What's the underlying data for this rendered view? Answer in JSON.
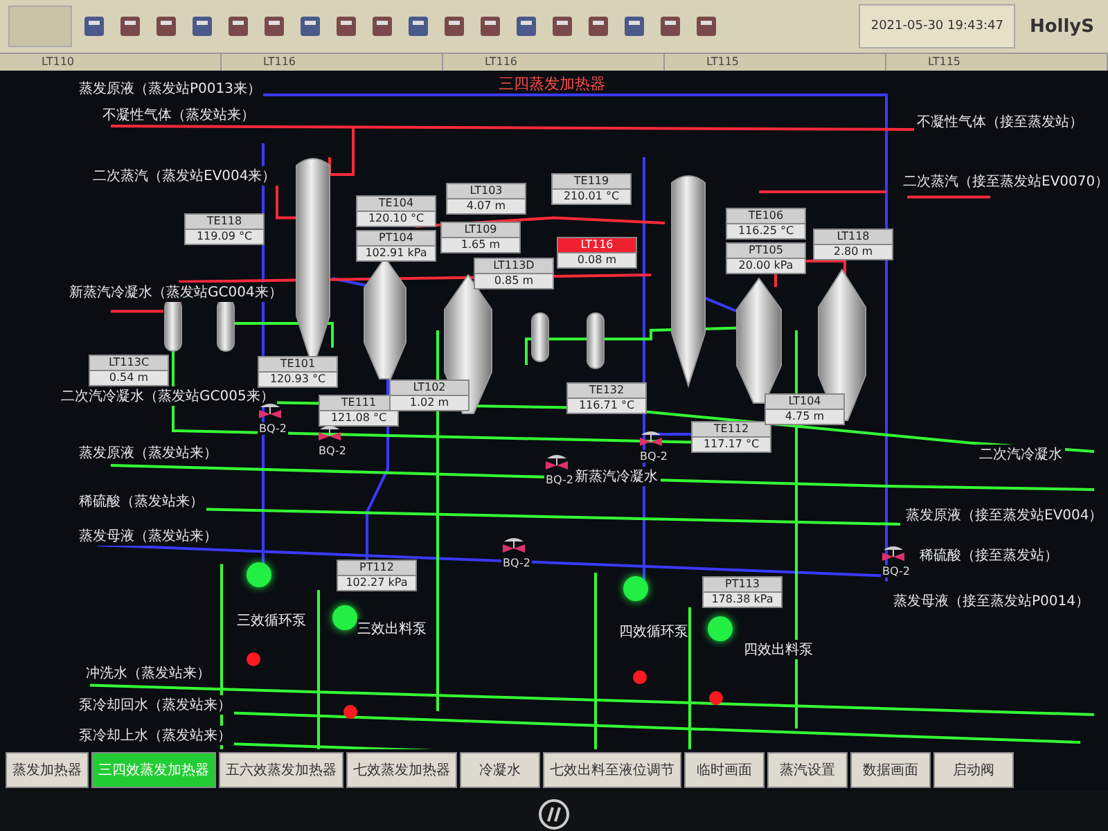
{
  "toolbar": {
    "datetime": "2021-05-30 19:43:47",
    "brand": "HollyS"
  },
  "tag_strip": [
    "LT110",
    "LT116",
    "LT116",
    "LT115",
    "LT115"
  ],
  "diagram": {
    "title": "三四蒸发加热器",
    "streams": [
      "蒸发原液（蒸发站P0013来）",
      "不凝性气体（蒸发站来）",
      "二次蒸汽（蒸发站EV004来）",
      "新蒸汽冷凝水（蒸发站GC004来）",
      "二次汽冷凝水（蒸发站GC005来）",
      "蒸发原液（蒸发站来）",
      "稀硫酸（蒸发站来）",
      "蒸发母液（蒸发站来）",
      "冲洗水（蒸发站来）",
      "泵冷却回水（蒸发站来）",
      "泵冷却上水（蒸发站来）",
      "不凝性气体（接至蒸发站）",
      "二次蒸汽（接至蒸发站EV0070）",
      "二次汽冷凝水",
      "蒸发原液（接至蒸发站EV004）",
      "稀硫酸（接至蒸发站）",
      "蒸发母液（接至蒸发站P0014）",
      "新蒸汽冷凝水"
    ],
    "instruments": [
      {
        "tag": "TE118",
        "value": "119.09 °C",
        "alarm": false
      },
      {
        "tag": "TE104",
        "value": "120.10 °C",
        "alarm": false
      },
      {
        "tag": "PT104",
        "value": "102.91 kPa",
        "alarm": false
      },
      {
        "tag": "LT103",
        "value": "4.07 m",
        "alarm": false
      },
      {
        "tag": "LT109",
        "value": "1.65 m",
        "alarm": false
      },
      {
        "tag": "LT113D",
        "value": "0.85 m",
        "alarm": false
      },
      {
        "tag": "TE119",
        "value": "210.01 °C",
        "alarm": false
      },
      {
        "tag": "LT116",
        "value": "0.08 m",
        "alarm": true
      },
      {
        "tag": "TE106",
        "value": "116.25 °C",
        "alarm": false
      },
      {
        "tag": "PT105",
        "value": "20.00 kPa",
        "alarm": false
      },
      {
        "tag": "LT118",
        "value": "2.80 m",
        "alarm": false
      },
      {
        "tag": "LT113C",
        "value": "0.54 m",
        "alarm": false
      },
      {
        "tag": "TE101",
        "value": "120.93 °C",
        "alarm": false
      },
      {
        "tag": "TE111",
        "value": "121.08 °C",
        "alarm": false
      },
      {
        "tag": "LT102",
        "value": "1.02 m",
        "alarm": false
      },
      {
        "tag": "TE132",
        "value": "116.71 °C",
        "alarm": false
      },
      {
        "tag": "TE112",
        "value": "117.17 °C",
        "alarm": false
      },
      {
        "tag": "LT104",
        "value": "4.75 m",
        "alarm": false
      },
      {
        "tag": "PT112",
        "value": "102.27 kPa",
        "alarm": false
      },
      {
        "tag": "PT113",
        "value": "178.38 kPa",
        "alarm": false
      }
    ],
    "valves": [
      {
        "label": "BQ-2"
      },
      {
        "label": "BQ-2"
      },
      {
        "label": "BQ-2"
      },
      {
        "label": "BQ-2"
      },
      {
        "label": "BQ-2"
      },
      {
        "label": "BQ-2"
      }
    ],
    "pumps": [
      {
        "name": "三效循环泵",
        "running": true,
        "alarm": true
      },
      {
        "name": "三效出料泵",
        "running": true,
        "alarm": true
      },
      {
        "name": "四效循环泵",
        "running": true,
        "alarm": true
      },
      {
        "name": "四效出料泵",
        "running": true,
        "alarm": true
      }
    ]
  },
  "nav_buttons": [
    {
      "label": "蒸发加热器",
      "selected": false
    },
    {
      "label": "三四效蒸发加热器",
      "selected": true
    },
    {
      "label": "五六效蒸发加热器",
      "selected": false
    },
    {
      "label": "七效蒸发加热器",
      "selected": false
    },
    {
      "label": "冷凝水",
      "selected": false
    },
    {
      "label": "七效出料至液位调节",
      "selected": false
    },
    {
      "label": "临时画面",
      "selected": false
    },
    {
      "label": "蒸汽设置",
      "selected": false
    },
    {
      "label": "数据画面",
      "selected": false
    },
    {
      "label": "启动阀",
      "selected": false
    }
  ]
}
